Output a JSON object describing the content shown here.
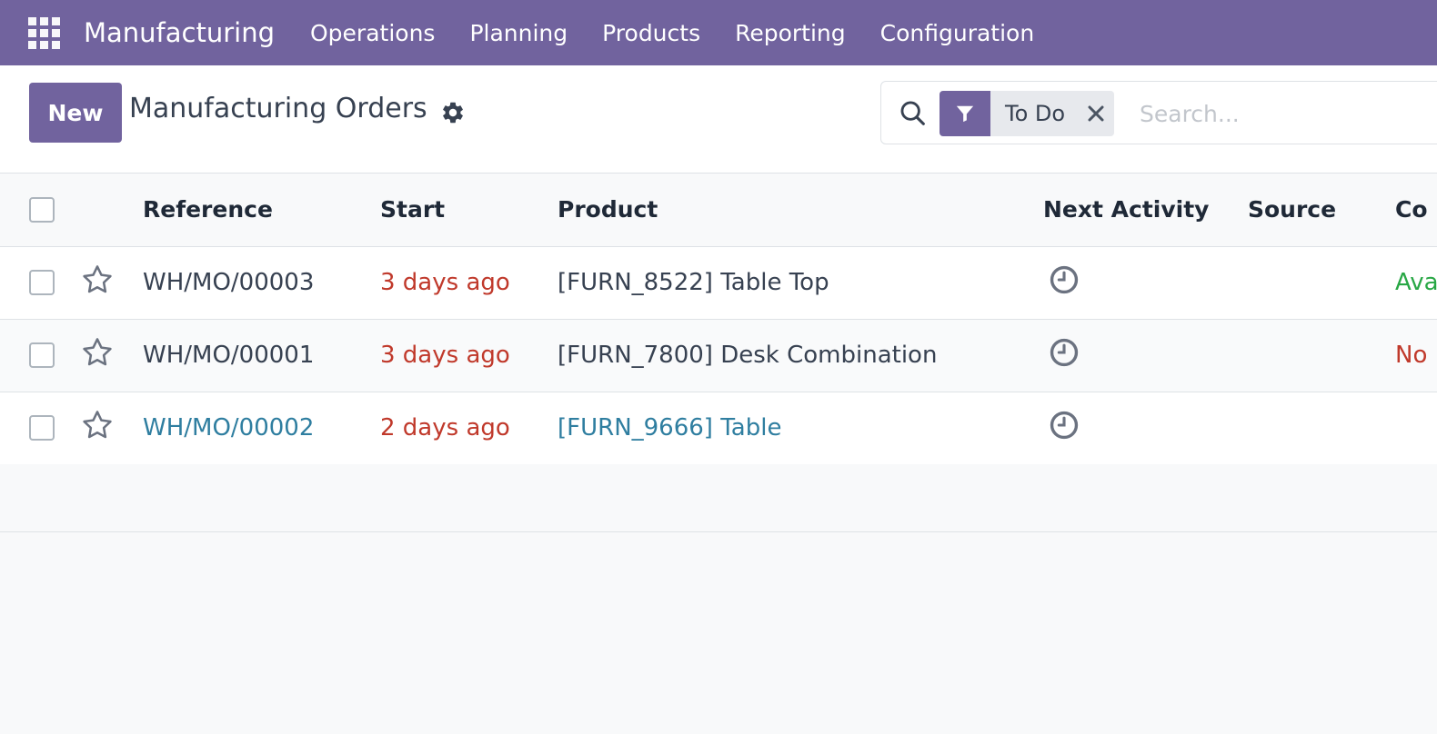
{
  "navbar": {
    "brand": "Manufacturing",
    "menu": [
      "Operations",
      "Planning",
      "Products",
      "Reporting",
      "Configuration"
    ],
    "color": "#71639e"
  },
  "control": {
    "new_label": "New",
    "title": "Manufacturing Orders",
    "search": {
      "facet_label": "To Do",
      "placeholder": "Search..."
    }
  },
  "table": {
    "columns": [
      "Reference",
      "Start",
      "Product",
      "Next Activity",
      "Source",
      "Co"
    ],
    "rows": [
      {
        "reference": "WH/MO/00003",
        "start": "3 days ago",
        "product": "[FURN_8522] Table Top",
        "source": "",
        "component_status": "Ava"
      },
      {
        "reference": "WH/MO/00001",
        "start": "3 days ago",
        "product": "[FURN_7800] Desk Combination",
        "source": "",
        "component_status": "No"
      },
      {
        "reference": "WH/MO/00002",
        "start": "2 days ago",
        "product": "[FURN_9666] Table",
        "source": "",
        "component_status": ""
      }
    ]
  }
}
